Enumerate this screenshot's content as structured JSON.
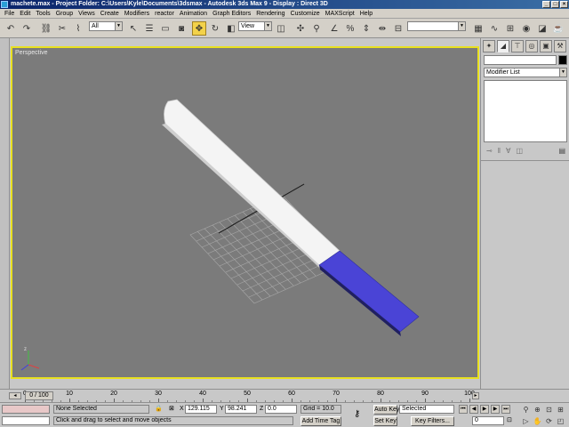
{
  "window": {
    "title": "machete.max   - Project Folder: C:\\Users\\Kyle\\Documents\\3dsmax    - Autodesk 3ds Max 9     - Display : Direct 3D",
    "buttons": [
      "_",
      "□",
      "×"
    ]
  },
  "menu": [
    "File",
    "Edit",
    "Tools",
    "Group",
    "Views",
    "Create",
    "Modifiers",
    "reactor",
    "Animation",
    "Graph Editors",
    "Rendering",
    "Customize",
    "MAXScript",
    "Help"
  ],
  "toolbar": {
    "selection_filter": "All",
    "reference_coord": "View",
    "named_selection": "",
    "icons": [
      "undo-icon",
      "redo-icon",
      "link-icon",
      "unlink-icon",
      "bind-spacewarp-icon",
      "select-icon",
      "select-by-name-icon",
      "rect-region-icon",
      "window-crossing-icon",
      "move-icon",
      "rotate-icon",
      "scale-icon",
      "pivot-icon",
      "manipulate-icon",
      "snap-icon",
      "angle-snap-icon",
      "percent-snap-icon",
      "spinner-snap-icon",
      "mirror-icon",
      "align-icon",
      "layers-icon",
      "curve-editor-icon",
      "schematic-icon",
      "material-editor-icon",
      "render-setup-icon",
      "quick-render-icon"
    ]
  },
  "viewport": {
    "label": "Perspective",
    "background": "#7b7b7b",
    "border_color": "#e8e020",
    "blade_color": "#ffffff",
    "handle_color": "#4040d0"
  },
  "command_panel": {
    "modifier_list": "Modifier List",
    "tabs": [
      "create-tab-icon",
      "modify-tab-icon",
      "hierarchy-tab-icon",
      "motion-tab-icon",
      "display-tab-icon",
      "utilities-tab-icon"
    ]
  },
  "time_slider": {
    "position": "0 / 100",
    "ticks": [
      "0",
      "10",
      "20",
      "30",
      "40",
      "50",
      "60",
      "70",
      "80",
      "90",
      "100"
    ]
  },
  "status": {
    "selection": "None Selected",
    "prompt": "Click and drag to select and move objects",
    "x_label": "X",
    "x_value": "129.115",
    "y_label": "Y",
    "y_value": "98.241",
    "z_label": "Z",
    "z_value": "0.0",
    "grid": "Grid = 10.0",
    "add_time_tag": "Add Time Tag",
    "auto_key": "Auto Key",
    "set_key": "Set Key",
    "key_mode": "Selected",
    "key_filters": "Key Filters...",
    "frame": "0"
  }
}
